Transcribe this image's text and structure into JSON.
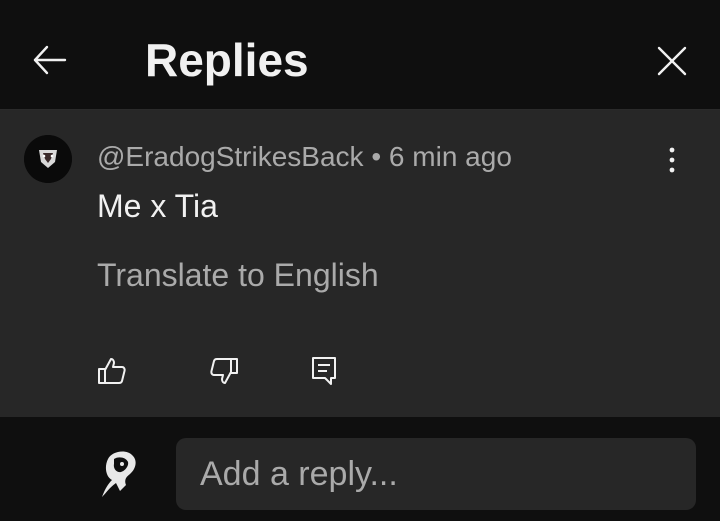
{
  "header": {
    "title": "Replies"
  },
  "comment": {
    "author": "@EradogStrikesBack",
    "separator": "•",
    "time": "6 min ago",
    "text": "Me x Tia",
    "translate_label": "Translate to English"
  },
  "reply_bar": {
    "placeholder": "Add a reply..."
  },
  "icons": {
    "back": "arrow-left-icon",
    "close": "close-icon",
    "more": "more-vertical-icon",
    "like": "thumbs-up-icon",
    "dislike": "thumbs-down-icon",
    "reply": "comment-reply-icon"
  },
  "colors": {
    "background": "#0f0f0f",
    "card": "#272727",
    "primary_text": "#f1f1f1",
    "secondary_text": "#aaaaaa",
    "input_background": "#272727"
  }
}
